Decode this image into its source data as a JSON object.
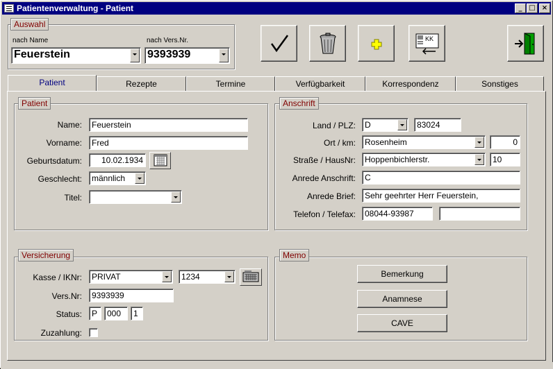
{
  "window": {
    "title": "Patientenverwaltung - Patient"
  },
  "auswahl": {
    "label": "Auswahl",
    "by_name_label": "nach Name",
    "by_name_value": "Feuerstein",
    "by_versnr_label": "nach Vers.Nr.",
    "by_versnr_value": "9393939"
  },
  "toolbar": {
    "ok": "checkmark-icon",
    "delete": "trash-icon",
    "new": "plus-icon",
    "insurance_card": "card-transfer-icon",
    "insurance_card_text": "KK",
    "exit": "exit-door-icon"
  },
  "tabs": [
    {
      "label": "Patient"
    },
    {
      "label": "Rezepte"
    },
    {
      "label": "Termine"
    },
    {
      "label": "Verfügbarkeit"
    },
    {
      "label": "Korrespondenz"
    },
    {
      "label": "Sonstiges"
    }
  ],
  "patient": {
    "group": "Patient",
    "name_label": "Name:",
    "name_value": "Feuerstein",
    "vorname_label": "Vorname:",
    "vorname_value": "Fred",
    "geburtsdatum_label": "Geburtsdatum:",
    "geburtsdatum_value": "10.02.1934",
    "geschlecht_label": "Geschlecht:",
    "geschlecht_value": "männlich",
    "titel_label": "Titel:",
    "titel_value": ""
  },
  "anschrift": {
    "group": "Anschrift",
    "land_plz_label": "Land  /  PLZ:",
    "land_value": "D",
    "plz_value": "83024",
    "ort_km_label": "Ort  /  km:",
    "ort_value": "Rosenheim",
    "km_value": "0",
    "strasse_label": "Straße  /  HausNr:",
    "strasse_value": "Hoppenbichlerstr.",
    "hausnr_value": "10",
    "anrede_anschrift_label": "Anrede Anschrift:",
    "anrede_anschrift_value": "C",
    "anrede_brief_label": "Anrede Brief:",
    "anrede_brief_value": "Sehr geehrter Herr Feuerstein,",
    "telefon_label": "Telefon  /  Telefax:",
    "telefon_value": "08044-93987",
    "telefax_value": ""
  },
  "versicherung": {
    "group": "Versicherung",
    "kasse_label": "Kasse  /  IKNr:",
    "kasse_value": "PRIVAT",
    "iknr_value": "1234",
    "versnr_label": "Vers.Nr:",
    "versnr_value": "9393939",
    "status_label": "Status:",
    "status_1": "P",
    "status_2": "000",
    "status_3": "1",
    "zuzahlung_label": "Zuzahlung:",
    "zuzahlung_checked": false
  },
  "memo": {
    "group": "Memo",
    "bemerkung": "Bemerkung",
    "anamnese": "Anamnese",
    "cave": "CAVE"
  }
}
